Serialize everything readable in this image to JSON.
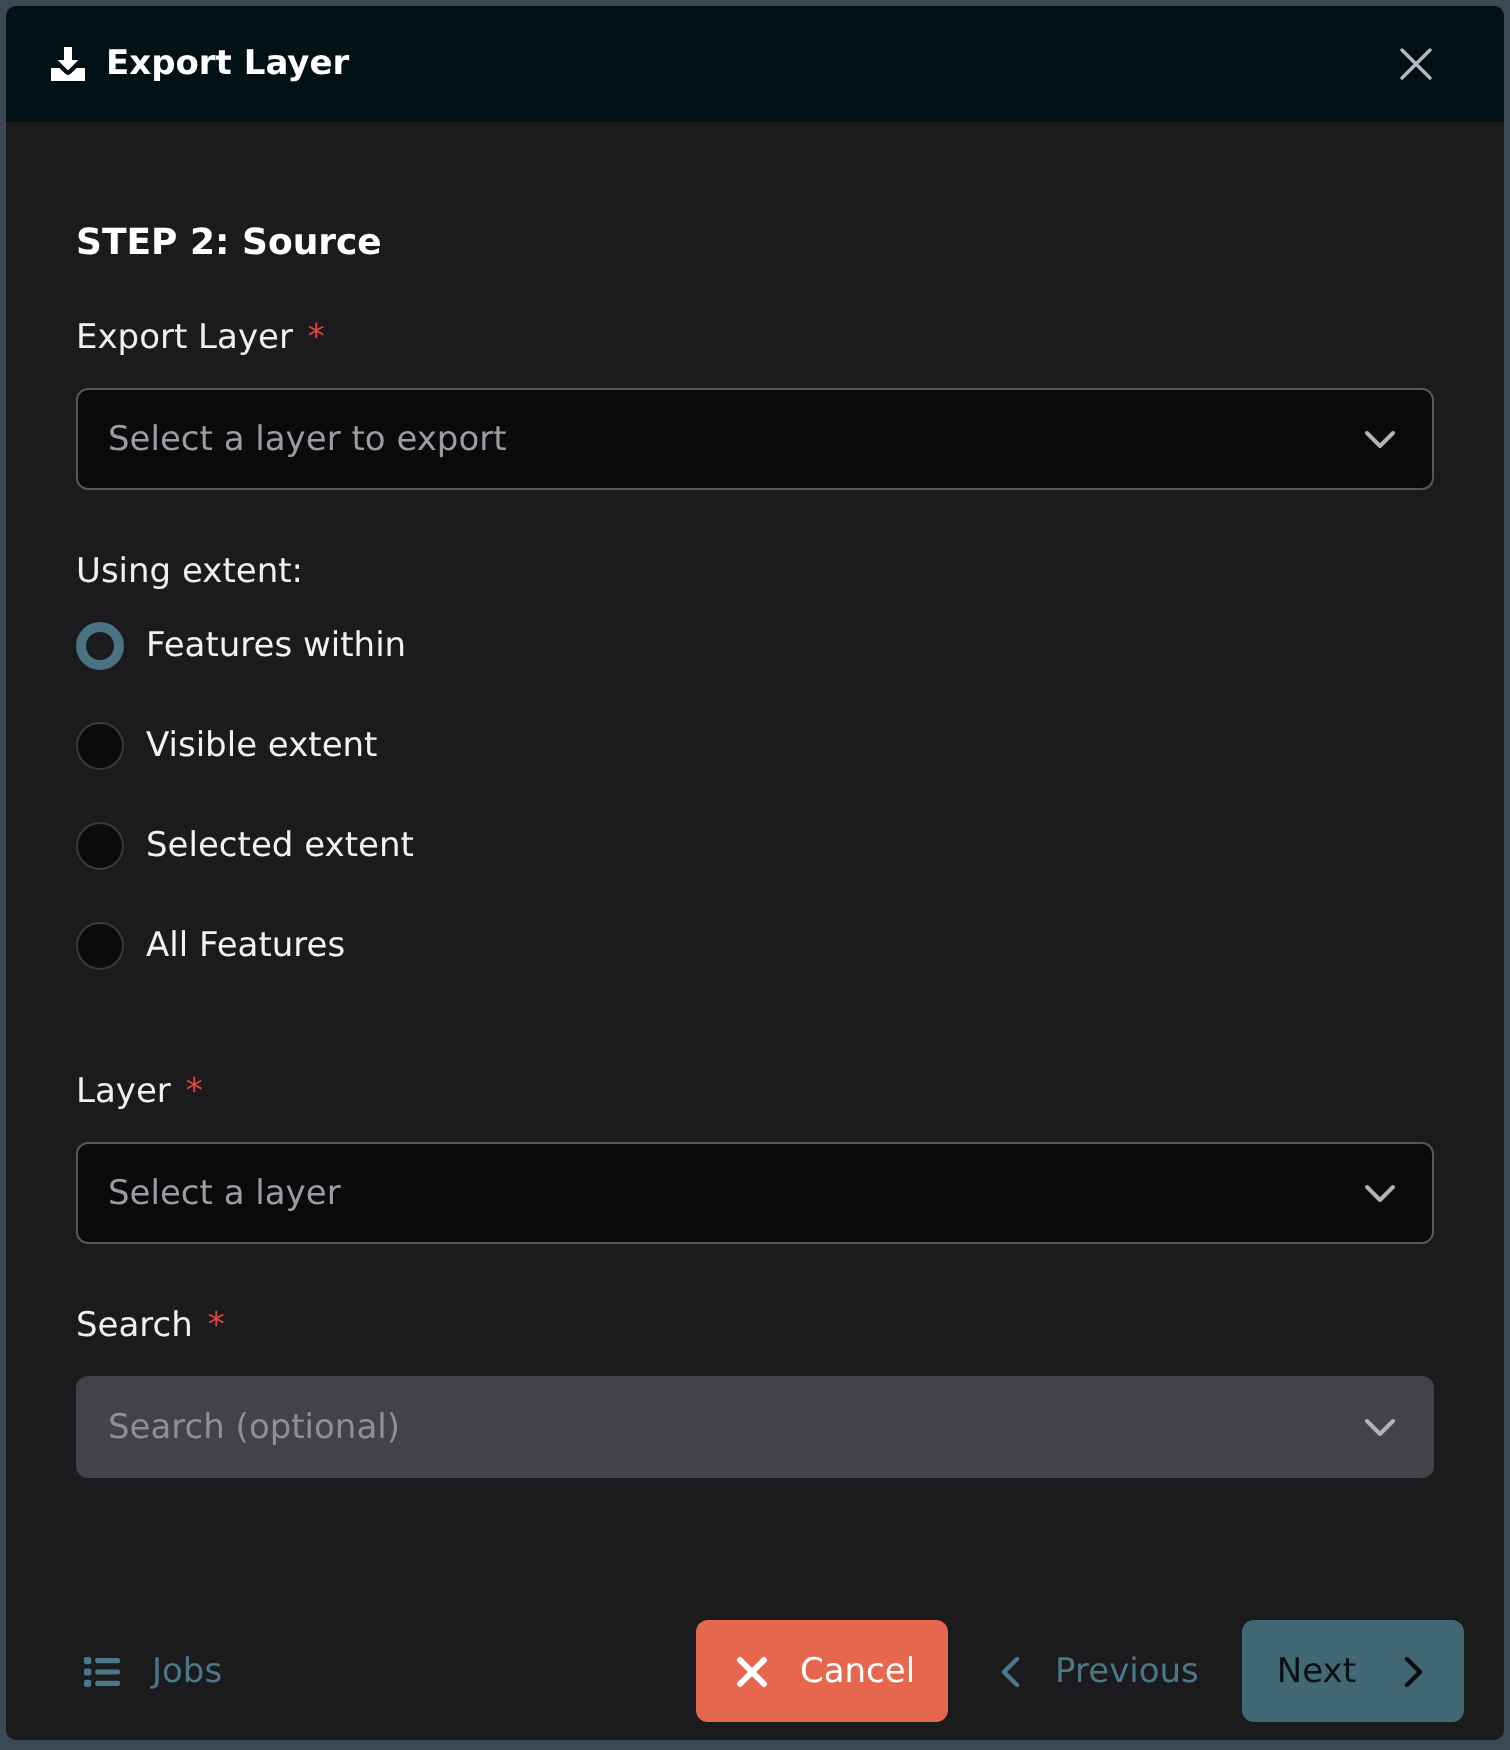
{
  "dialog": {
    "title": "Export Layer"
  },
  "step_heading": "STEP 2: Source",
  "fields": [
    {
      "kind": "select",
      "label": "Export Layer",
      "required_mark": "*",
      "placeholder": "Select a layer to export",
      "disabled": false
    },
    {
      "kind": "radio_group",
      "label": "Using extent:",
      "options": [
        {
          "label": "Features within",
          "selected": true
        },
        {
          "label": "Visible extent",
          "selected": false
        },
        {
          "label": "Selected extent",
          "selected": false
        },
        {
          "label": "All Features",
          "selected": false
        }
      ]
    },
    {
      "kind": "select",
      "label": "Layer",
      "required_mark": "*",
      "placeholder": "Select a layer",
      "disabled": false
    },
    {
      "kind": "select",
      "label": "Search",
      "required_mark": "*",
      "placeholder": "Search (optional)",
      "disabled": true
    }
  ],
  "footer": {
    "jobs_link": "Jobs",
    "buttons": [
      {
        "kind": "cancel",
        "label": "Cancel",
        "disabled": false
      },
      {
        "kind": "previous",
        "label": "Previous",
        "disabled": false
      },
      {
        "kind": "next",
        "label": "Next",
        "disabled": true
      }
    ]
  }
}
